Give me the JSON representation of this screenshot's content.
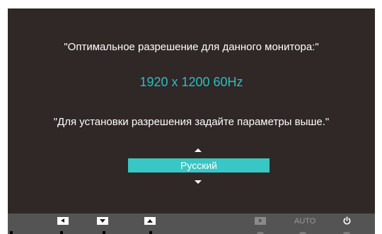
{
  "osd": {
    "message_top": "\"Оптимальное разрешение для данного монитора:\"",
    "resolution": "1920 x 1200  60Hz",
    "message_bottom": "\"Для установки разрешения задайте параметры выше.\"",
    "language_selected": "Русский",
    "colors": {
      "background": "#2f2826",
      "accent": "#38c7c4",
      "resolution_text": "#2bbfc0",
      "bottom_bar": "#545454"
    }
  },
  "bottom_bar": {
    "buttons": [
      {
        "icon": "left-arrow-icon"
      },
      {
        "icon": "down-arrow-icon"
      },
      {
        "icon": "up-arrow-icon"
      },
      {
        "icon": "right-arrow-icon"
      }
    ],
    "auto_label": "AUTO",
    "power_icon": "power-icon"
  }
}
